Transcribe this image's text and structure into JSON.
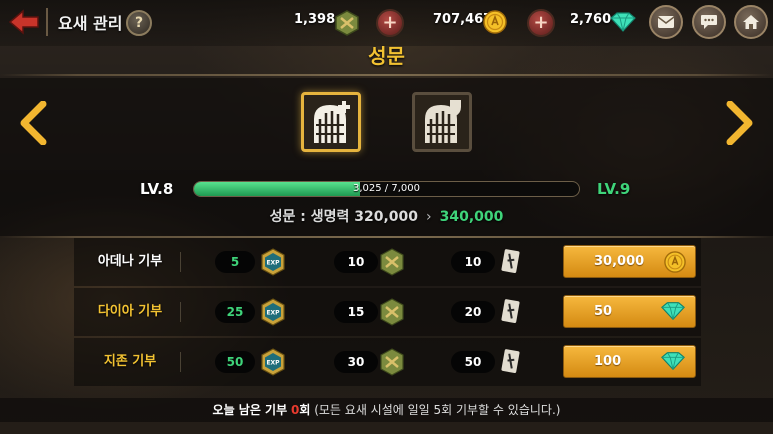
{
  "header": {
    "title": "요새 관리",
    "help_label": "?",
    "medal_count": "1,398",
    "gold_amount": "707,467",
    "diamond_count": "2,760",
    "add_label": "+"
  },
  "page_title": "성문",
  "gate_upgrade": {
    "level_current": "LV.8",
    "level_next": "LV.9",
    "progress_text": "3,025 / 7,000",
    "progress": 0.432,
    "stat_label": "성문 : 생명력 320,000",
    "stat_arrow": "›",
    "stat_next": "340,000"
  },
  "donations": [
    {
      "label": "아데나 기부",
      "exp": "5",
      "medal": "10",
      "ticket": "10",
      "cost": "30,000",
      "cost_icon": "gold-coin-icon"
    },
    {
      "label": "다이아 기부",
      "exp": "25",
      "medal": "15",
      "ticket": "20",
      "cost": "50",
      "cost_icon": "diamond-icon"
    },
    {
      "label": "지존 기부",
      "exp": "50",
      "medal": "30",
      "ticket": "50",
      "cost": "100",
      "cost_icon": "diamond-icon"
    }
  ],
  "footer": {
    "prefix": "오늘 남은 기부",
    "count": "0",
    "suffix_unit": "회",
    "note": "(모든 요새 시설에 일일 5회 기부할 수 있습니다.)"
  },
  "colors": {
    "accent_gold": "#f2c232",
    "progress_green": "#3fd47a",
    "remaining_red": "#e83a2e"
  }
}
